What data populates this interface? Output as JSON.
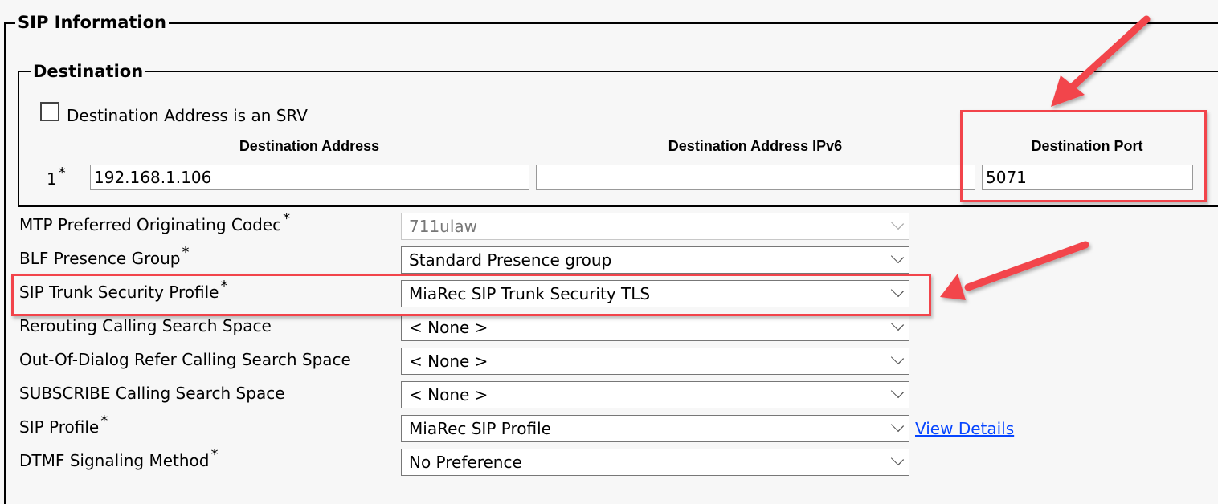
{
  "sections": {
    "sip_information": {
      "title": "SIP Information"
    },
    "destination": {
      "title": "Destination"
    }
  },
  "destination": {
    "srv_checkbox": {
      "label": "Destination Address is an SRV",
      "checked": false
    },
    "columns": {
      "address": "Destination Address",
      "address_ipv6": "Destination Address IPv6",
      "port": "Destination Port"
    },
    "rows": [
      {
        "index": "1",
        "required_mark": "*",
        "address": "192.168.1.106",
        "address_ipv6": "",
        "port": "5071"
      }
    ]
  },
  "fields": [
    {
      "label": "MTP Preferred Originating Codec",
      "required": "*",
      "value": "711ulaw",
      "disabled": true
    },
    {
      "label": "BLF Presence Group",
      "required": "*",
      "value": "Standard Presence group"
    },
    {
      "label": "SIP Trunk Security Profile",
      "required": "*",
      "value": "MiaRec SIP Trunk Security TLS"
    },
    {
      "label": "Rerouting Calling Search Space",
      "required": "",
      "value": "< None >"
    },
    {
      "label": "Out-Of-Dialog Refer Calling Search Space",
      "required": "",
      "value": "< None >"
    },
    {
      "label": "SUBSCRIBE Calling Search Space",
      "required": "",
      "value": "< None >"
    },
    {
      "label": "SIP Profile",
      "required": "*",
      "value": "MiaRec SIP Profile"
    },
    {
      "label": "DTMF Signaling Method",
      "required": "*",
      "value": "No Preference"
    }
  ],
  "links": {
    "view_details": "View Details"
  },
  "annotations": {
    "highlight_color": "#f2444b"
  }
}
